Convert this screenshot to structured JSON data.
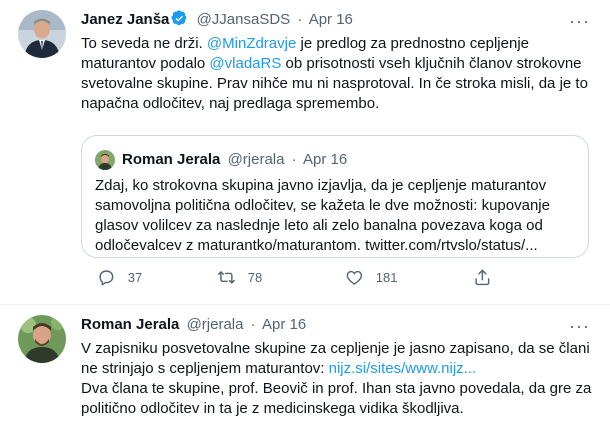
{
  "tweet1": {
    "name": "Janez Janša",
    "handle": "@JJansaSDS",
    "sep": "·",
    "date": "Apr 16",
    "more": "···",
    "body": {
      "p1": "To seveda ne drži. ",
      "mention1": "@MinZdravje",
      "p2": " je predlog za prednostno cepljenje maturantov podalo ",
      "mention2": "@vladaRS",
      "p3": " ob prisotnosti vseh ključnih članov strokovne svetovalne skupine. Prav nihče mu ni nasprotoval. In če stroka misli, da je to napačna odločitev, naj predlaga spremembo."
    },
    "quote": {
      "name": "Roman Jerala",
      "handle": "@rjerala",
      "sep": "·",
      "date": "Apr 16",
      "text": "Zdaj, ko strokovna skupina javno izjavlja, da je cepljenje maturantov samovoljna politična odločitev, se kažeta le dve možnosti: kupovanje glasov volilcev za naslednje leto ali zelo banalna povezava koga od odločevalcev z maturantko/maturantom. twitter.com/rtvslo/status/..."
    },
    "actions": {
      "replies": "37",
      "retweets": "78",
      "likes": "181"
    }
  },
  "tweet2": {
    "name": "Roman Jerala",
    "handle": "@rjerala",
    "sep": "·",
    "date": "Apr 16",
    "more": "···",
    "body": {
      "p1": "V zapisniku posvetovalne skupine za cepljenje je jasno zapisano, da se člani ne strinjajo s cepljenjem maturantov: ",
      "link": "nijz.si/sites/www.nijz...",
      "p2": "Dva člana te skupine, prof. Beovič in prof. Ihan sta javno povedala, da gre za politično odločitev in ta je z medicinskega vidika škodljiva."
    }
  },
  "colors": {
    "link": "#1d9bf0",
    "muted": "#536471",
    "text": "#0f1419",
    "border": "#cfd9de"
  }
}
